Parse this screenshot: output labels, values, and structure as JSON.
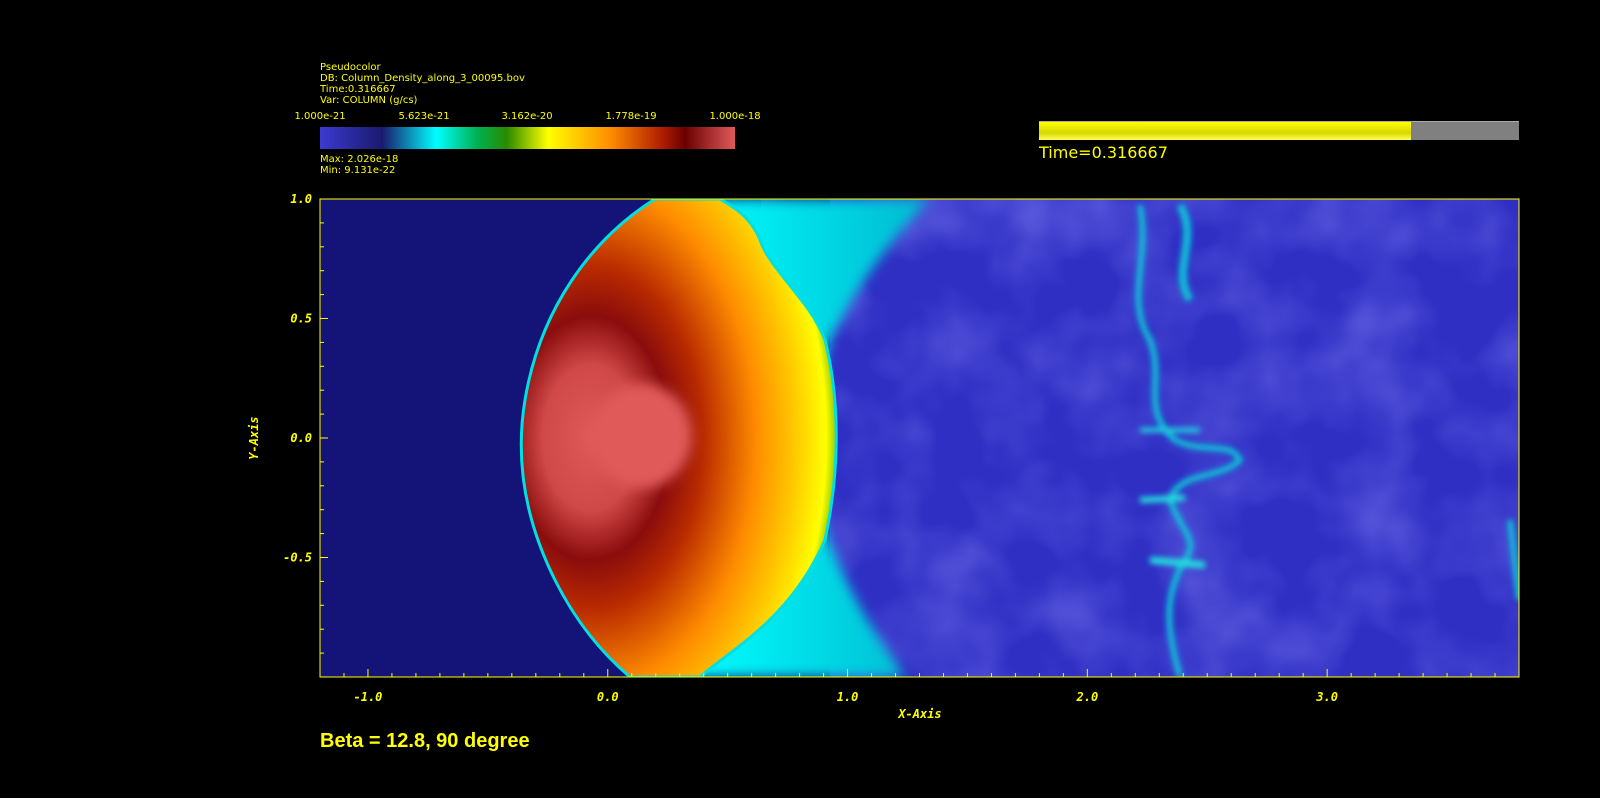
{
  "legend": {
    "plot_type": "Pseudocolor",
    "db": "DB: Column_Density_along_3_00095.bov",
    "time": "Time:0.316667",
    "var": "Var: COLUMN (g/cs)",
    "ticks": [
      "1.000e-21",
      "5.623e-21",
      "3.162e-20",
      "1.778e-19",
      "1.000e-18"
    ],
    "max": "Max:  2.026e-18",
    "min": "Min:  9.131e-22"
  },
  "time_slider": {
    "label": "Time=0.316667",
    "progress": 0.775
  },
  "bottom_title": "Beta = 12.8, 90 degree",
  "colors": {
    "text": "#ffff00",
    "background": "#000000"
  },
  "chart_data": {
    "type": "heatmap",
    "title": "",
    "xlabel": "X-Axis",
    "ylabel": "Y-Axis",
    "xlim": [
      -1.2,
      3.8
    ],
    "ylim": [
      -1.0,
      1.0
    ],
    "xticks": [
      -1.0,
      0.0,
      1.0,
      2.0,
      3.0
    ],
    "xtick_labels": [
      "-1.0",
      "0.0",
      "1.0",
      "2.0",
      "3.0"
    ],
    "yticks": [
      1.0,
      0.5,
      0.0,
      -0.5
    ],
    "ytick_labels": [
      "1.0",
      "0.5",
      "0.0",
      "-0.5"
    ],
    "colorscale": "log",
    "color_range": [
      1e-21,
      1e-18
    ],
    "grid": false
  }
}
